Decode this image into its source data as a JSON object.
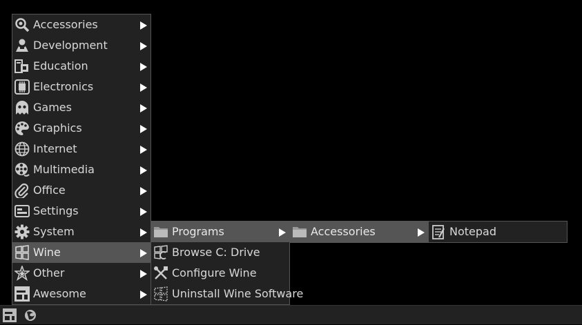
{
  "main_menu": {
    "items": [
      {
        "label": "Accessories",
        "icon": "magnifier-icon"
      },
      {
        "label": "Development",
        "icon": "tools-icon"
      },
      {
        "label": "Education",
        "icon": "education-icon"
      },
      {
        "label": "Electronics",
        "icon": "chip-icon"
      },
      {
        "label": "Games",
        "icon": "ghost-icon"
      },
      {
        "label": "Graphics",
        "icon": "palette-icon"
      },
      {
        "label": "Internet",
        "icon": "globe-icon"
      },
      {
        "label": "Multimedia",
        "icon": "film-reel-icon"
      },
      {
        "label": "Office",
        "icon": "paperclip-icon"
      },
      {
        "label": "Settings",
        "icon": "settings-panel-icon"
      },
      {
        "label": "System",
        "icon": "gear-icon"
      },
      {
        "label": "Wine",
        "icon": "wine-window-icon"
      },
      {
        "label": "Other",
        "icon": "star-icon"
      },
      {
        "label": "Awesome",
        "icon": "awesome-logo-icon"
      }
    ],
    "active": "Wine"
  },
  "wine_menu": {
    "items": [
      {
        "label": "Programs",
        "icon": "folder-icon"
      },
      {
        "label": "Browse C: Drive",
        "icon": "browse-drive-icon"
      },
      {
        "label": "Configure Wine",
        "icon": "configure-icon"
      },
      {
        "label": "Uninstall Wine Software",
        "icon": "uninstall-icon"
      }
    ],
    "active": "Programs"
  },
  "programs_menu": {
    "items": [
      {
        "label": "Accessories",
        "icon": "folder-icon"
      }
    ],
    "active": "Accessories"
  },
  "programs_accessories_menu": {
    "items": [
      {
        "label": "Notepad",
        "icon": "notepad-icon"
      }
    ]
  },
  "taskbar": {
    "icons": [
      "awesome-launcher-icon",
      "firefox-icon"
    ]
  },
  "colors": {
    "background": "#000000",
    "menu_bg": "#222222",
    "highlight": "#555555",
    "text": "#d8d8d8"
  }
}
